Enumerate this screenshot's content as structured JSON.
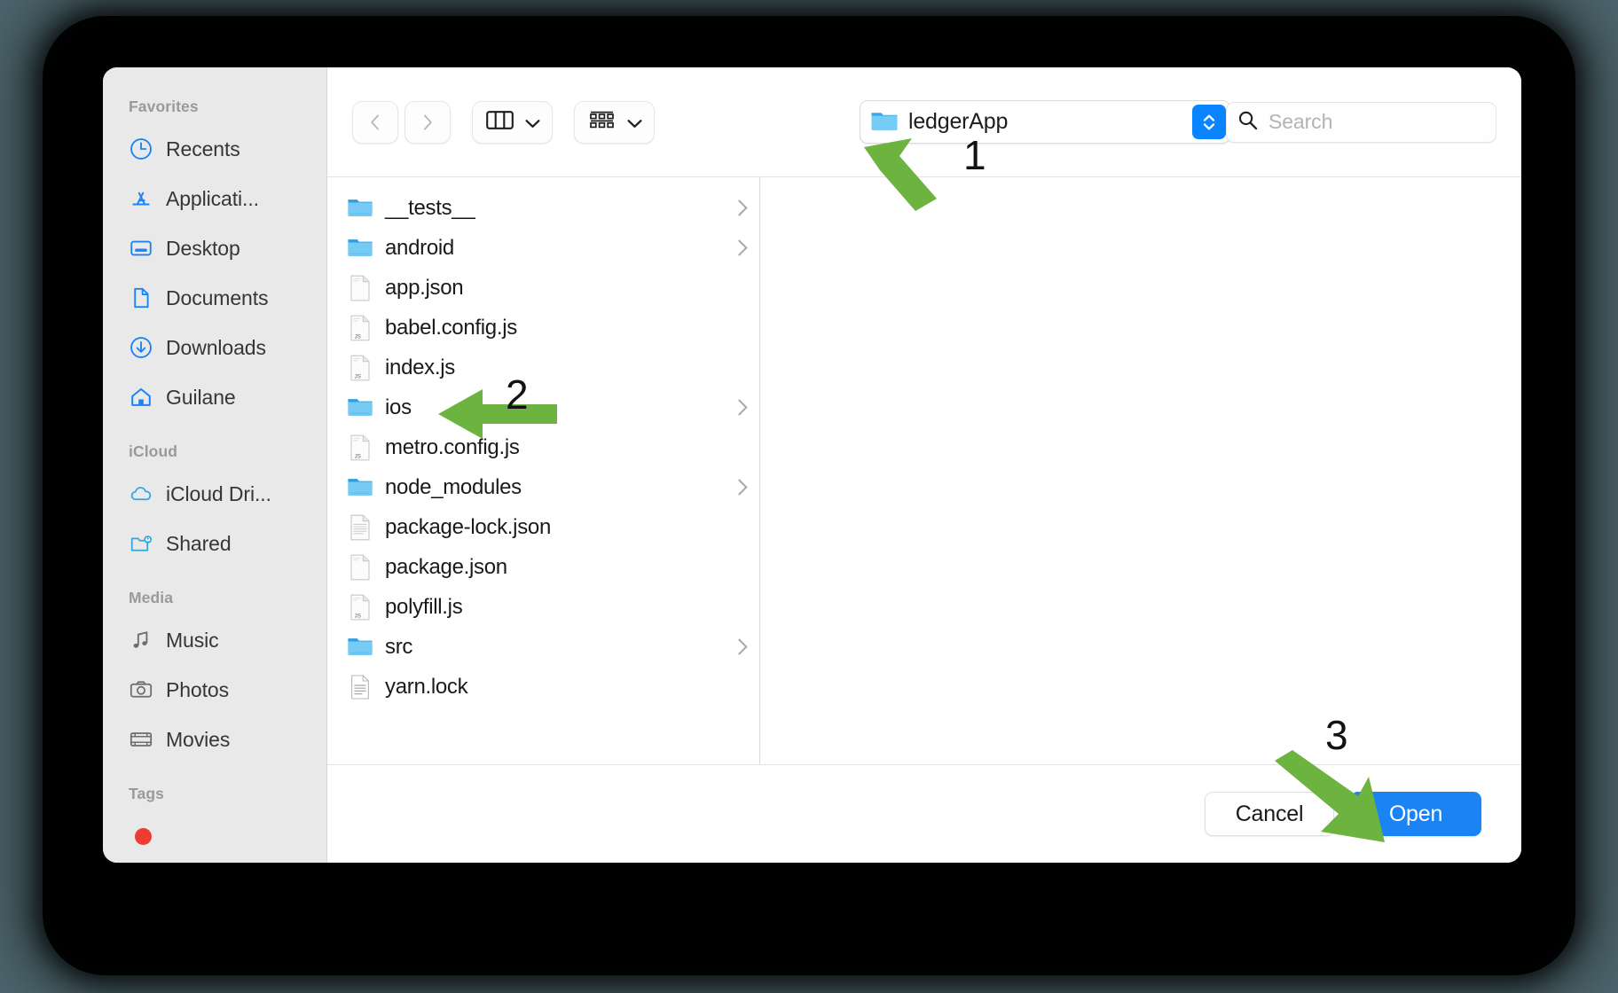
{
  "window": {
    "kind": "macos-open-file-dialog",
    "background_color": "#4d656d",
    "frame_color": "#000000",
    "accent_color": "#1a84f4"
  },
  "sidebar": {
    "groups": [
      {
        "title": "Favorites",
        "items": [
          {
            "label": "Recents",
            "icon": "clock-icon"
          },
          {
            "label": "Applicati...",
            "icon": "applications-icon"
          },
          {
            "label": "Desktop",
            "icon": "desktop-icon"
          },
          {
            "label": "Documents",
            "icon": "document-icon"
          },
          {
            "label": "Downloads",
            "icon": "download-icon"
          },
          {
            "label": "Guilane",
            "icon": "home-icon"
          }
        ]
      },
      {
        "title": "iCloud",
        "items": [
          {
            "label": "iCloud Dri...",
            "icon": "cloud-icon"
          },
          {
            "label": "Shared",
            "icon": "shared-folder-icon"
          }
        ]
      },
      {
        "title": "Media",
        "items": [
          {
            "label": "Music",
            "icon": "music-note-icon"
          },
          {
            "label": "Photos",
            "icon": "camera-icon"
          },
          {
            "label": "Movies",
            "icon": "film-icon"
          }
        ]
      },
      {
        "title": "Tags",
        "items": [
          {
            "label": "",
            "icon": "red-tag-dot-icon"
          }
        ]
      }
    ]
  },
  "toolbar": {
    "back_icon": "chevron-left-icon",
    "forward_icon": "chevron-right-icon",
    "view_mode_icon": "column-view-icon",
    "view_mode_chevron": "chevron-down-icon",
    "group_icon": "group-by-icon",
    "group_chevron": "chevron-down-icon",
    "path_popup": {
      "label": "ledgerApp",
      "icon": "folder-icon",
      "stepper_icon": "stepper-up-down-icon"
    },
    "search": {
      "placeholder": "Search",
      "value": "",
      "icon": "search-icon"
    }
  },
  "file_list": [
    {
      "name": "__tests__",
      "type": "folder",
      "has_children": true
    },
    {
      "name": "android",
      "type": "folder",
      "has_children": true
    },
    {
      "name": "app.json",
      "type": "file-plain",
      "has_children": false
    },
    {
      "name": "babel.config.js",
      "type": "file-js",
      "has_children": false
    },
    {
      "name": "index.js",
      "type": "file-js",
      "has_children": false
    },
    {
      "name": "ios",
      "type": "folder",
      "has_children": true
    },
    {
      "name": "metro.config.js",
      "type": "file-js",
      "has_children": false
    },
    {
      "name": "node_modules",
      "type": "folder",
      "has_children": true
    },
    {
      "name": "package-lock.json",
      "type": "file-text",
      "has_children": false
    },
    {
      "name": "package.json",
      "type": "file-plain",
      "has_children": false
    },
    {
      "name": "polyfill.js",
      "type": "file-js",
      "has_children": false
    },
    {
      "name": "src",
      "type": "folder",
      "has_children": true
    },
    {
      "name": "yarn.lock",
      "type": "file-lines",
      "has_children": false
    }
  ],
  "buttons": {
    "cancel_label": "Cancel",
    "open_label": "Open"
  },
  "annotations": {
    "color": "#6cb33f",
    "steps": [
      {
        "number": "1",
        "target": "path-popup"
      },
      {
        "number": "2",
        "target": "file-row-ios"
      },
      {
        "number": "3",
        "target": "open-button"
      }
    ]
  }
}
